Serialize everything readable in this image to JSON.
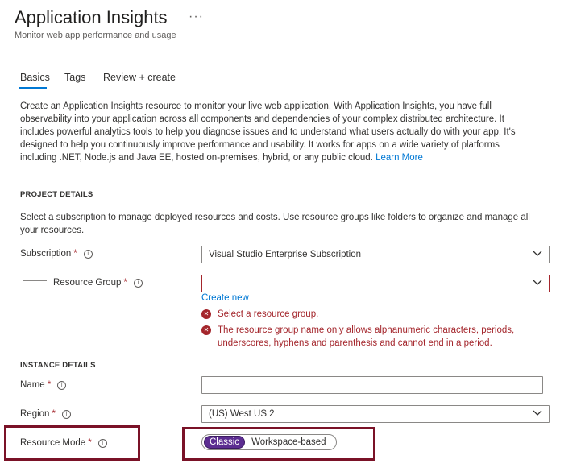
{
  "header": {
    "title": "Application Insights",
    "more": "···",
    "subtitle": "Monitor web app performance and usage"
  },
  "tabs": [
    {
      "label": "Basics",
      "active": true
    },
    {
      "label": "Tags",
      "active": false
    },
    {
      "label": "Review + create",
      "active": false
    }
  ],
  "intro": {
    "text": "Create an Application Insights resource to monitor your live web application. With Application Insights, you have full observability into your application across all components and dependencies of your complex distributed architecture. It includes powerful analytics tools to help you diagnose issues and to understand what users actually do with your app. It's designed to help you continuously improve performance and usability. It works for apps on a wide variety of platforms including .NET, Node.js and Java EE, hosted on-premises, hybrid, or any public cloud.",
    "link": "Learn More"
  },
  "project_details": {
    "heading": "PROJECT DETAILS",
    "description": "Select a subscription to manage deployed resources and costs. Use resource groups like folders to organize and manage all your resources.",
    "subscription": {
      "label": "Subscription",
      "value": "Visual Studio Enterprise Subscription"
    },
    "resource_group": {
      "label": "Resource Group",
      "value": "",
      "create_new": "Create new",
      "errors": [
        "Select a resource group.",
        "The resource group name only allows alphanumeric characters, periods, underscores, hyphens and parenthesis and cannot end in a period."
      ]
    }
  },
  "instance_details": {
    "heading": "INSTANCE DETAILS",
    "name": {
      "label": "Name",
      "value": ""
    },
    "region": {
      "label": "Region",
      "value": "(US) West US 2"
    },
    "resource_mode": {
      "label": "Resource Mode",
      "options": [
        "Classic",
        "Workspace-based"
      ],
      "selected": "Classic"
    }
  },
  "required_marker": "*",
  "info_glyph": "i",
  "error_glyph": "✕",
  "colors": {
    "accent": "#0078d4",
    "error": "#a4262c",
    "highlight": "#7a1227",
    "toggle_selected": "#5c2d91"
  }
}
